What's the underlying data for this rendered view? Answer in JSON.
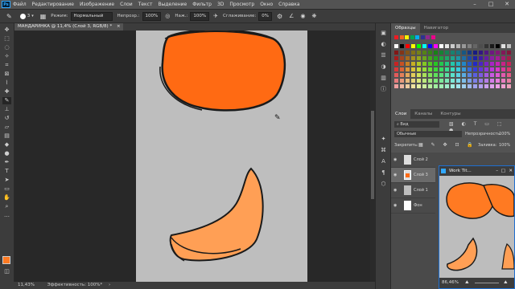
{
  "menu": {
    "app_icon": "Ps",
    "items": [
      "Файл",
      "Редактирование",
      "Изображение",
      "Слои",
      "Текст",
      "Выделение",
      "Фильтр",
      "3D",
      "Просмотр",
      "Окно",
      "Справка"
    ]
  },
  "options": {
    "brush_size": "3",
    "mode_label": "Режим:",
    "mode_value": "Нормальный",
    "opacity_label": "Непрозр.:",
    "opacity_value": "100%",
    "pressure_label": "Наж.:",
    "pressure_value": "100%",
    "smoothing_label": "Сглаживание:",
    "smoothing_value": "0%"
  },
  "document": {
    "tab_title": "МАНДАРИНКА @ 11,4% (Слой 3, RGB/8) *",
    "colors": {
      "orange": "#ff6a13",
      "light_orange": "#ff9f55",
      "stroke": "#1a1a1a",
      "canvas": "#bebebe"
    }
  },
  "status": {
    "zoom": "11,43%",
    "info": "Эффективность: 100%*"
  },
  "panels": {
    "swatch_tabs": [
      "Образцы",
      "Навигатор"
    ],
    "layer_tabs": [
      "Слои",
      "Каналы",
      "Контуры"
    ],
    "layer_kind": "Вид",
    "blend_mode": "Обычные",
    "opacity_label": "Непрозрачность:",
    "opacity_value": "100%",
    "lock_label": "Закрепить:",
    "fill_label": "Заливка:",
    "fill_value": "100%",
    "layers": [
      {
        "name": "Слой 2",
        "selected": false
      },
      {
        "name": "Слой 3",
        "selected": true
      },
      {
        "name": "Слой 1",
        "selected": false
      },
      {
        "name": "Фон",
        "selected": false
      }
    ]
  },
  "navigator": {
    "title": "Work Tit...",
    "zoom": "86,46%"
  },
  "swatch_colors": {
    "row1": [
      "#ffffff",
      "#000000",
      "#ff0000",
      "#ffff00",
      "#00ff00",
      "#00ffff",
      "#0000ff",
      "#ff00ff",
      "#ffffff",
      "#e6e6e6",
      "#cccccc",
      "#b3b3b3",
      "#999999",
      "#808080",
      "#666666",
      "#4d4d4d",
      "#333333",
      "#1a1a1a",
      "#000000",
      "#e0e0e0",
      "#c0c0c0"
    ],
    "top": [
      "#ed1c24",
      "#f26522",
      "#fff200",
      "#00a651",
      "#00aeef",
      "#2e3192",
      "#92278f",
      "#ec008c"
    ]
  }
}
